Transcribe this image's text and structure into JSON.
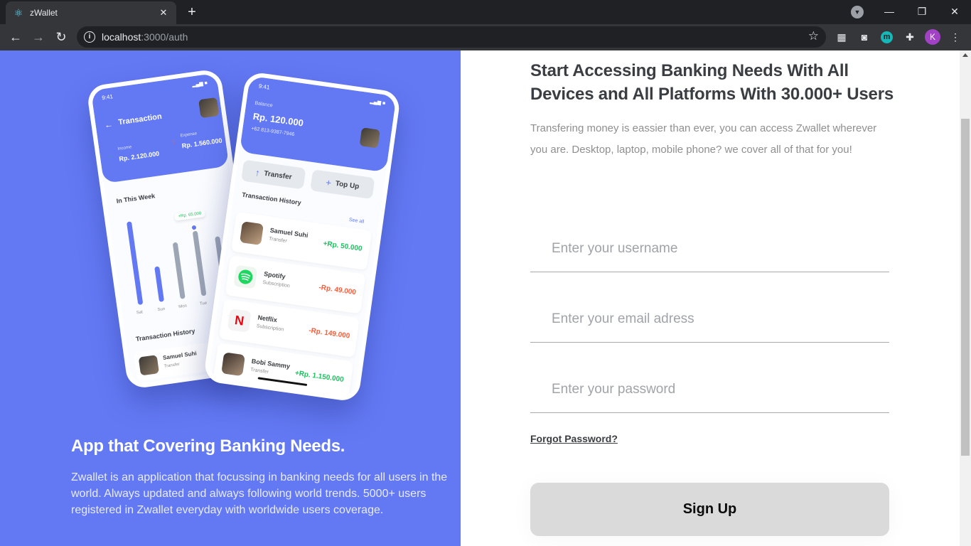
{
  "browser": {
    "tab_title": "zWallet",
    "url_host": "localhost",
    "url_path": ":3000/auth",
    "profile_initial": "K",
    "extension_m": "m"
  },
  "promo": {
    "title": "App that Covering Banking Needs.",
    "description": "Zwallet is an application that focussing in banking needs for all users in the world. Always updated and always following world trends. 5000+ users registered in Zwallet everyday with worldwide users coverage."
  },
  "phone_back": {
    "time": "9:41",
    "title": "Transaction",
    "income_label": "Income",
    "income_value": "Rp. 2.120.000",
    "expense_label": "Expense",
    "expense_value": "Rp. 1.560.000",
    "week_label": "In This Week",
    "tooltip": "+Rp. 65.000",
    "days": [
      "Sat",
      "Sun",
      "Mon",
      "Tue"
    ],
    "history_label": "Transaction History",
    "history_name": "Samuel Suhi",
    "history_sub": "Transfer"
  },
  "phone_front": {
    "time": "9:41",
    "balance_label": "Balance",
    "balance_value": "Rp. 120.000",
    "phone_number": "+62 813-9387-7946",
    "transfer_label": "Transfer",
    "topup_label": "Top Up",
    "history_label": "Transaction History",
    "see_all": "See all",
    "transactions": [
      {
        "name": "Samuel Suhi",
        "type": "Transfer",
        "amount": "+Rp. 50.000"
      },
      {
        "name": "Spotify",
        "type": "Subscription",
        "amount": "-Rp. 49.000"
      },
      {
        "name": "Netflix",
        "type": "Subscription",
        "amount": "-Rp. 149.000"
      },
      {
        "name": "Bobi Sammy",
        "type": "Transfer",
        "amount": "+Rp. 1.150.000"
      }
    ]
  },
  "auth": {
    "heading": "Start Accessing Banking Needs With All Devices and All Platforms With 30.000+ Users",
    "subtext": "Transfering money is eassier than ever, you can access Zwallet wherever you are. Desktop, laptop, mobile phone? we cover all of that for you!",
    "username_placeholder": "Enter your username",
    "email_placeholder": "Enter your email adress",
    "password_placeholder": "Enter your password",
    "forgot_label": "Forgot Password?",
    "signup_label": "Sign Up"
  },
  "colors": {
    "primary": "#6379f4",
    "income": "#1ec15f",
    "expense": "#ff5b37",
    "button_disabled": "#dadada"
  }
}
